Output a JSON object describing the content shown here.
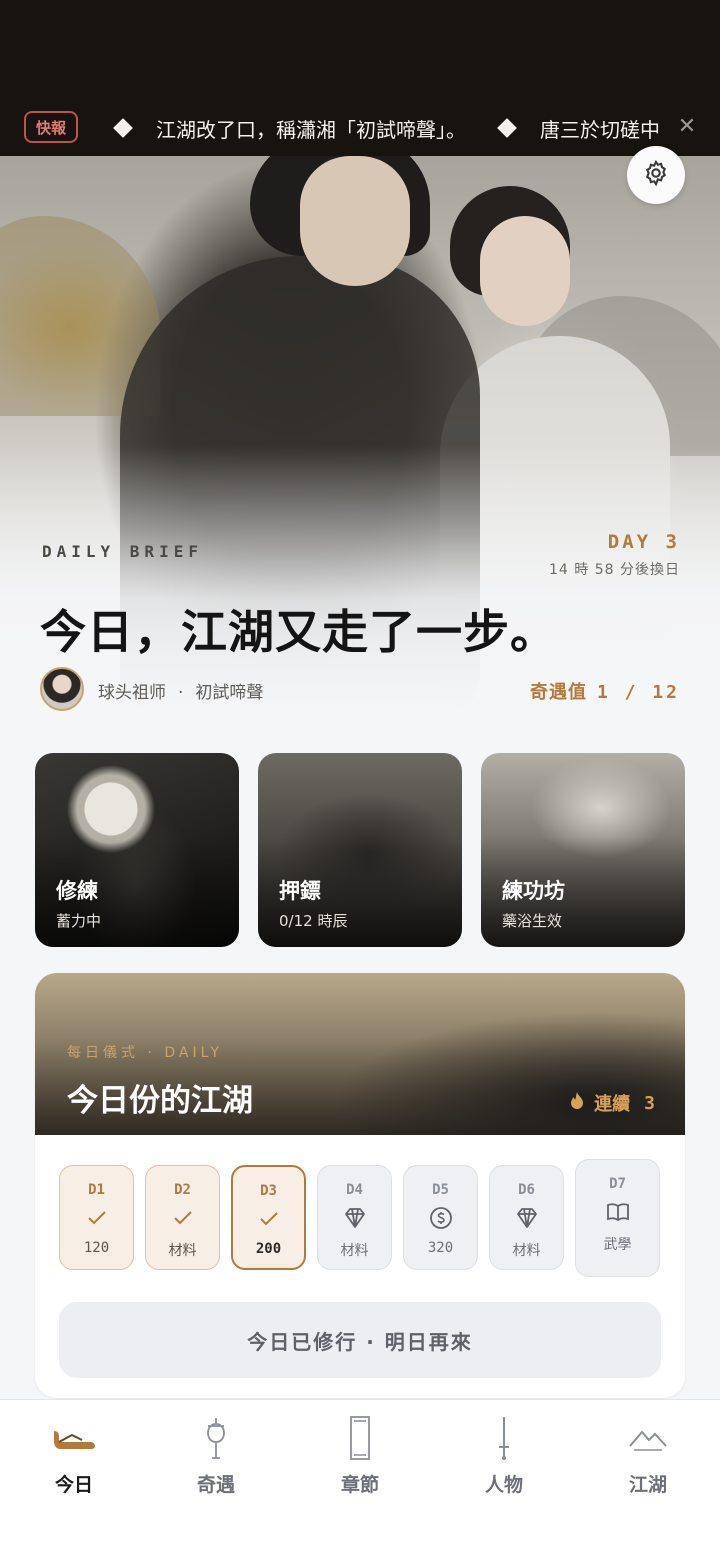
{
  "ticker": {
    "badge": "快報",
    "items": [
      "江湖改了口，稱瀟湘「初試啼聲」。",
      "唐三於切磋中"
    ]
  },
  "hero": {
    "brief_label": "DAILY BRIEF",
    "day_label": "DAY 3",
    "countdown": "14 時 58 分後換日",
    "headline": "今日，江湖又走了一步。",
    "user_name": "球头祖师",
    "separator": "·",
    "user_title": "初試啼聲",
    "qiyu_label": "奇遇值",
    "qiyu_value": "1 / 12"
  },
  "activities": [
    {
      "title": "修練",
      "subtitle": "蓄力中"
    },
    {
      "title": "押鏢",
      "subtitle": "0/12 時辰"
    },
    {
      "title": "練功坊",
      "subtitle": "藥浴生效"
    }
  ],
  "daily": {
    "tag": "每日儀式 · DAILY",
    "title": "今日份的江湖",
    "streak_label": "連續",
    "streak_value": "3",
    "days": [
      {
        "label": "D1",
        "reward": "120",
        "state": "done",
        "icon": "check-icon"
      },
      {
        "label": "D2",
        "reward": "材料",
        "state": "done",
        "icon": "check-icon"
      },
      {
        "label": "D3",
        "reward": "200",
        "state": "today",
        "icon": "check-icon"
      },
      {
        "label": "D4",
        "reward": "材料",
        "state": "future",
        "icon": "gem-icon"
      },
      {
        "label": "D5",
        "reward": "320",
        "state": "future",
        "icon": "coin-icon"
      },
      {
        "label": "D6",
        "reward": "材料",
        "state": "future",
        "icon": "gem-icon"
      },
      {
        "label": "D7",
        "reward": "武學",
        "state": "future",
        "icon": "book-icon"
      }
    ],
    "button_label": "今日已修行 · 明日再來"
  },
  "nav": [
    {
      "label": "今日",
      "icon": "scroll-icon",
      "active": true
    },
    {
      "label": "奇遇",
      "icon": "lantern-icon",
      "active": false
    },
    {
      "label": "章節",
      "icon": "book-spine-icon",
      "active": false
    },
    {
      "label": "人物",
      "icon": "sword-icon",
      "active": false
    },
    {
      "label": "江湖",
      "icon": "mountain-icon",
      "active": false
    }
  ],
  "colors": {
    "accent": "#b47a3a",
    "ticker_bg": "#17140f",
    "badge_red": "#c0514b"
  }
}
